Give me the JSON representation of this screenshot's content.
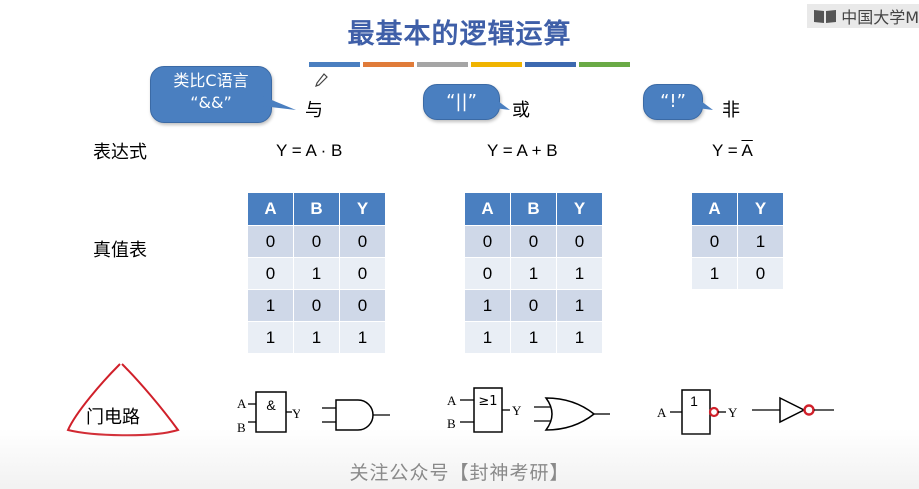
{
  "title": "最基本的逻辑运算",
  "watermark_top": "中国大学M",
  "color_bars": [
    "#4a7fc0",
    "#e07b39",
    "#a5a5a5",
    "#f0b400",
    "#3c69b0",
    "#6aaa46"
  ],
  "and_bubble": {
    "line1": "类比C语言",
    "line2": "“&&”"
  },
  "or_bubble": "“||”",
  "not_bubble": "“!”",
  "ops": {
    "and": "与",
    "or": "或",
    "not": "非"
  },
  "row_labels": {
    "expression": "表达式",
    "truth_table": "真值表",
    "gate": "门电路"
  },
  "expressions": {
    "and": "Y = A · B",
    "or": "Y = A + B",
    "not_prefix": "Y = ",
    "not_var": "A"
  },
  "and_table": {
    "headers": [
      "A",
      "B",
      "Y"
    ],
    "rows": [
      [
        "0",
        "0",
        "0"
      ],
      [
        "0",
        "1",
        "0"
      ],
      [
        "1",
        "0",
        "0"
      ],
      [
        "1",
        "1",
        "1"
      ]
    ]
  },
  "or_table": {
    "headers": [
      "A",
      "B",
      "Y"
    ],
    "rows": [
      [
        "0",
        "0",
        "0"
      ],
      [
        "0",
        "1",
        "1"
      ],
      [
        "1",
        "0",
        "1"
      ],
      [
        "1",
        "1",
        "1"
      ]
    ]
  },
  "not_table": {
    "headers": [
      "A",
      "Y"
    ],
    "rows": [
      [
        "0",
        "1"
      ],
      [
        "1",
        "0"
      ]
    ]
  },
  "gates": {
    "and_symbol": "&",
    "or_symbol": "≥1",
    "not_symbol": "1",
    "in_a": "A",
    "in_b": "B",
    "out_y": "Y"
  },
  "footer": "关注公众号【封神考研】"
}
